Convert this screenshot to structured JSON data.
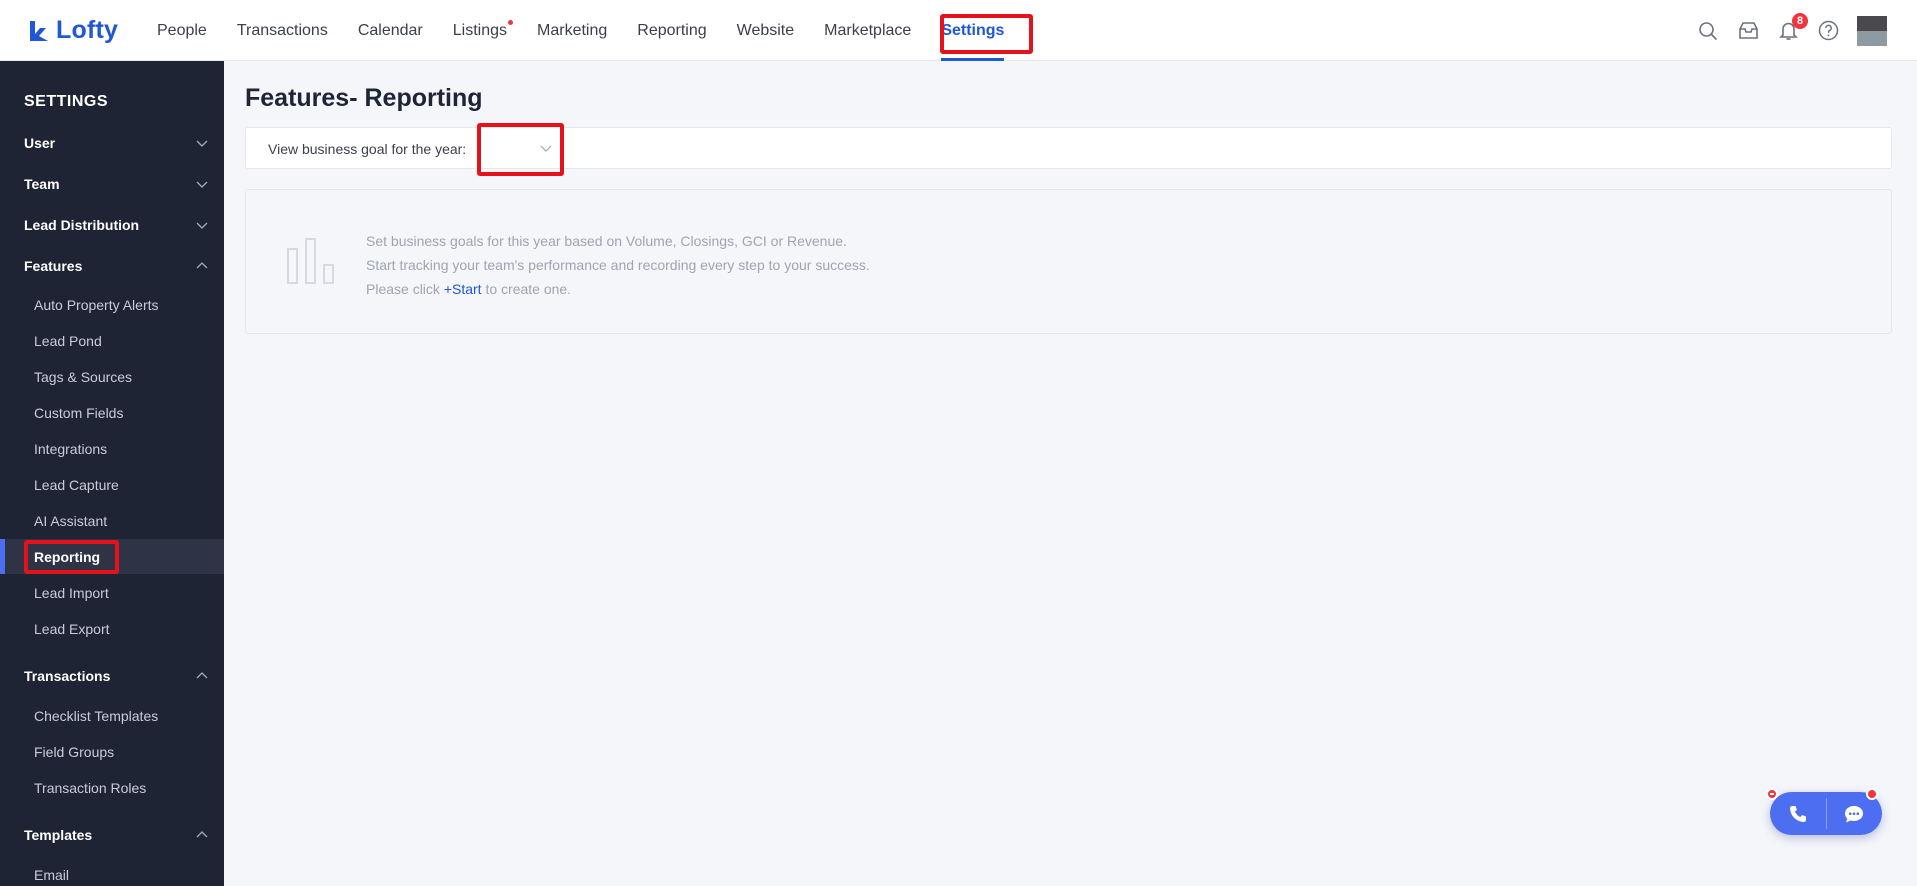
{
  "header": {
    "logo_text": "Lofty",
    "nav": [
      {
        "label": "People"
      },
      {
        "label": "Transactions"
      },
      {
        "label": "Calendar"
      },
      {
        "label": "Listings"
      },
      {
        "label": "Marketing"
      },
      {
        "label": "Reporting"
      },
      {
        "label": "Website"
      },
      {
        "label": "Marketplace"
      },
      {
        "label": "Settings"
      }
    ],
    "active_nav": "Settings",
    "notification_count": "8",
    "icons": [
      "search-icon",
      "inbox-icon",
      "bell-icon",
      "help-icon"
    ]
  },
  "sidebar": {
    "title": "SETTINGS",
    "groups": {
      "user": "User",
      "team": "Team",
      "lead_distribution": "Lead Distribution",
      "features": "Features",
      "transactions": "Transactions",
      "templates": "Templates"
    },
    "features_items": [
      "Auto Property Alerts",
      "Lead Pond",
      "Tags & Sources",
      "Custom Fields",
      "Integrations",
      "Lead Capture",
      "AI Assistant",
      "Reporting",
      "Lead Import",
      "Lead Export"
    ],
    "transactions_items": [
      "Checklist Templates",
      "Field Groups",
      "Transaction Roles"
    ],
    "templates_items": [
      "Email"
    ],
    "active_item": "Reporting"
  },
  "main": {
    "title": "Features- Reporting",
    "filter_label": "View business goal for the year:",
    "year_value": "",
    "empty": {
      "line1": "Set business goals for this year based on Volume, Closings, GCI or Revenue.",
      "line2": "Start tracking your team's performance and recording every step to your success.",
      "line3_prefix": "Please click",
      "line3_link": "+Start",
      "line3_suffix": "to create one."
    }
  },
  "colors": {
    "brand": "#1f57d6",
    "sidebar_bg": "#1e2434",
    "highlight": "#e5121b",
    "widget": "#4e6ef2"
  }
}
